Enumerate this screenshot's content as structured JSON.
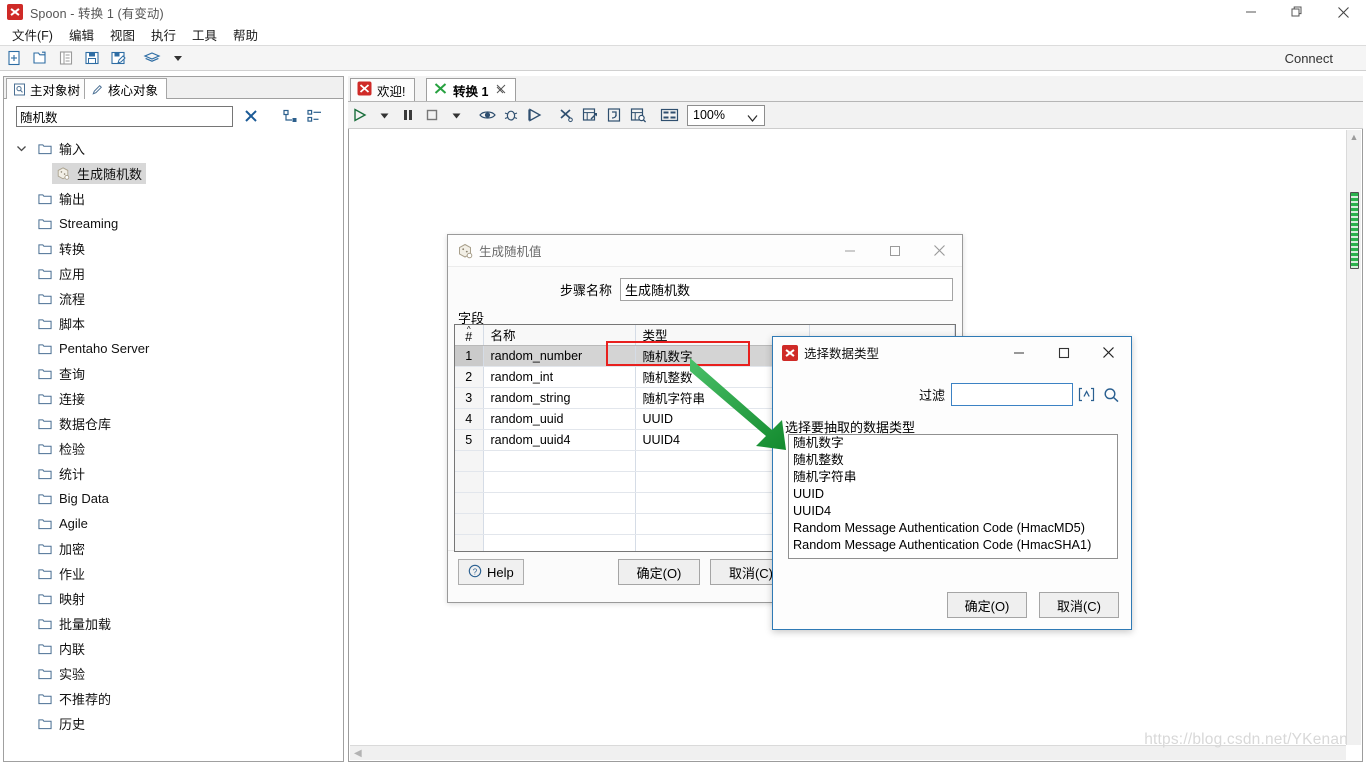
{
  "window": {
    "title": "Spoon - 转换 1 (有变动)",
    "icon": "spoon-app-icon",
    "minimize": "−",
    "restore": "❐",
    "close": "✕"
  },
  "menubar": {
    "items": [
      {
        "label": "文件(F)",
        "name": "menu-file"
      },
      {
        "label": "编辑",
        "name": "menu-edit"
      },
      {
        "label": "视图",
        "name": "menu-view"
      },
      {
        "label": "执行",
        "name": "menu-run"
      },
      {
        "label": "工具",
        "name": "menu-tools"
      },
      {
        "label": "帮助",
        "name": "menu-help"
      }
    ]
  },
  "toolbar": {
    "buttons": [
      {
        "name": "new-file-icon",
        "title": "新建"
      },
      {
        "name": "open-file-icon",
        "title": "打开"
      },
      {
        "name": "explore-repository-icon",
        "title": "资源库浏览"
      },
      {
        "name": "save-icon",
        "title": "保存"
      },
      {
        "name": "save-as-icon",
        "title": "另存为"
      },
      {
        "name": "layers-icon",
        "title": "透视图"
      },
      {
        "name": "chevron-down-icon",
        "title": "更多"
      }
    ],
    "connect_label": "Connect"
  },
  "left_panel": {
    "tabs": [
      {
        "label": "主对象树",
        "icon": "document-tree-icon",
        "active": false
      },
      {
        "label": "核心对象",
        "icon": "pencil-icon",
        "active": true
      }
    ],
    "filter": {
      "value": "随机数",
      "placeholder": "",
      "clear_icon": "close-x-icon",
      "collapse_all_icon": "collapse-all-icon",
      "expand_all_icon": "expand-all-icon"
    },
    "tree": [
      {
        "label": "输入",
        "icon": "folder-icon",
        "expanded": true,
        "level": 0,
        "selected": false
      },
      {
        "label": "生成随机数",
        "icon": "random-step-icon",
        "level": 1,
        "selected": true
      },
      {
        "label": "输出",
        "icon": "folder-icon",
        "level": 0,
        "selected": false
      },
      {
        "label": "Streaming",
        "icon": "folder-icon",
        "level": 0,
        "selected": false
      },
      {
        "label": "转换",
        "icon": "folder-icon",
        "level": 0,
        "selected": false
      },
      {
        "label": "应用",
        "icon": "folder-icon",
        "level": 0,
        "selected": false
      },
      {
        "label": "流程",
        "icon": "folder-icon",
        "level": 0,
        "selected": false
      },
      {
        "label": "脚本",
        "icon": "folder-icon",
        "level": 0,
        "selected": false
      },
      {
        "label": "Pentaho Server",
        "icon": "folder-icon",
        "level": 0,
        "selected": false
      },
      {
        "label": "查询",
        "icon": "folder-icon",
        "level": 0,
        "selected": false
      },
      {
        "label": "连接",
        "icon": "folder-icon",
        "level": 0,
        "selected": false
      },
      {
        "label": "数据仓库",
        "icon": "folder-icon",
        "level": 0,
        "selected": false
      },
      {
        "label": "检验",
        "icon": "folder-icon",
        "level": 0,
        "selected": false
      },
      {
        "label": "统计",
        "icon": "folder-icon",
        "level": 0,
        "selected": false
      },
      {
        "label": "Big Data",
        "icon": "folder-icon",
        "level": 0,
        "selected": false
      },
      {
        "label": "Agile",
        "icon": "folder-icon",
        "level": 0,
        "selected": false
      },
      {
        "label": "加密",
        "icon": "folder-icon",
        "level": 0,
        "selected": false
      },
      {
        "label": "作业",
        "icon": "folder-icon",
        "level": 0,
        "selected": false
      },
      {
        "label": "映射",
        "icon": "folder-icon",
        "level": 0,
        "selected": false
      },
      {
        "label": "批量加载",
        "icon": "folder-icon",
        "level": 0,
        "selected": false
      },
      {
        "label": "内联",
        "icon": "folder-icon",
        "level": 0,
        "selected": false
      },
      {
        "label": "实验",
        "icon": "folder-icon",
        "level": 0,
        "selected": false
      },
      {
        "label": "不推荐的",
        "icon": "folder-icon",
        "level": 0,
        "selected": false
      },
      {
        "label": "历史",
        "icon": "folder-icon",
        "level": 0,
        "selected": false
      }
    ]
  },
  "editor": {
    "tabs": [
      {
        "label": "欢迎!",
        "icon": "spoon-welcome-icon",
        "active": false,
        "closable": false
      },
      {
        "label": "转换 1",
        "icon": "transformation-icon",
        "active": true,
        "closable": true,
        "close_icon": "close-x-icon"
      }
    ],
    "toolbar": {
      "buttons": [
        {
          "name": "run-icon",
          "title": "运行"
        },
        {
          "name": "run-dropdown-icon",
          "title": "运行选项"
        },
        {
          "name": "pause-icon",
          "title": "暂停"
        },
        {
          "name": "stop-icon",
          "title": "停止"
        },
        {
          "name": "stop-dropdown-icon",
          "title": "停止选项"
        },
        {
          "name": "preview-icon",
          "title": "预览"
        },
        {
          "name": "debug-icon",
          "title": "调试"
        },
        {
          "name": "replay-icon",
          "title": "重放"
        },
        {
          "name": "transformation-settings-icon",
          "title": "转换设置"
        },
        {
          "name": "show-impact-icon",
          "title": "影响分析"
        },
        {
          "name": "generate-sql-icon",
          "title": "生成SQL"
        },
        {
          "name": "explore-db-icon",
          "title": "浏览数据库"
        },
        {
          "name": "grid-align-icon",
          "title": "对齐网格"
        }
      ],
      "zoom": {
        "value": "100%",
        "dropdown_icon": "chevron-down-icon"
      }
    },
    "hscroll_icon": "chevron-left-icon",
    "vscroll_up_icon": "chevron-up-icon",
    "watermark": "https://blog.csdn.net/YKenan"
  },
  "dialog_random": {
    "title": "生成随机值",
    "icon": "random-step-icon",
    "minimize": "−",
    "maximize": "▢",
    "close": "✕",
    "step_name_label": "步骤名称",
    "step_name_value": "生成随机数",
    "fields_label": "字段",
    "columns": [
      "#",
      "名称",
      "类型",
      ""
    ],
    "rows": [
      {
        "n": "1",
        "name": "random_number",
        "type": "随机数字",
        "selected": true
      },
      {
        "n": "2",
        "name": "random_int",
        "type": "随机整数",
        "selected": false
      },
      {
        "n": "3",
        "name": "random_string",
        "type": "随机字符串",
        "selected": false
      },
      {
        "n": "4",
        "name": "random_uuid",
        "type": "UUID",
        "selected": false
      },
      {
        "n": "5",
        "name": "random_uuid4",
        "type": "UUID4",
        "selected": false
      },
      {
        "n": "",
        "name": "",
        "type": "",
        "selected": false
      },
      {
        "n": "",
        "name": "",
        "type": "",
        "selected": false
      },
      {
        "n": "",
        "name": "",
        "type": "",
        "selected": false
      },
      {
        "n": "",
        "name": "",
        "type": "",
        "selected": false
      },
      {
        "n": "",
        "name": "",
        "type": "",
        "selected": false
      }
    ],
    "help_label": "Help",
    "help_icon": "question-mark-icon",
    "ok_label": "确定(O)",
    "cancel_label": "取消(C)"
  },
  "dialog_datatype": {
    "title": "选择数据类型",
    "icon": "spoon-app-icon",
    "minimize": "−",
    "maximize": "▢",
    "close": "✕",
    "filter_label": "过滤",
    "filter_value": "",
    "regex_icon": "regex-icon",
    "search_icon": "search-icon",
    "hint": "选择要抽取的数据类型",
    "options": [
      "随机数字",
      "随机整数",
      "随机字符串",
      "UUID",
      "UUID4",
      "Random Message Authentication Code (HmacMD5)",
      "Random Message Authentication Code (HmacSHA1)"
    ],
    "ok_label": "确定(O)",
    "cancel_label": "取消(C)"
  },
  "annotations": {
    "highlight_color": "#e8201e",
    "arrow_color": "#1aa33a",
    "highlight_target": "随机数字",
    "arrow_name": "green-annotation-arrow"
  }
}
